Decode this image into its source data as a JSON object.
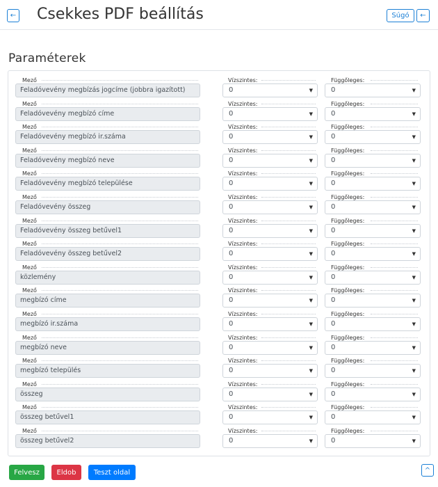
{
  "header": {
    "title": "Csekkes PDF beállítás",
    "help_label": "Súgó",
    "back_icon": "←"
  },
  "section": {
    "title": "Paraméterek"
  },
  "labels": {
    "field": "Mező",
    "horizontal": "Vízszintes:",
    "vertical": "Függőleges:"
  },
  "select_caret": "▼",
  "rows": [
    {
      "field": "Feladóvevény megbízás jogcíme (jobbra igazított)",
      "horizontal": "0",
      "vertical": "0"
    },
    {
      "field": "Feladóvevény megbízó címe",
      "horizontal": "0",
      "vertical": "0"
    },
    {
      "field": "Feladóvevény megbízó ir.száma",
      "horizontal": "0",
      "vertical": "0"
    },
    {
      "field": "Feladóvevény megbízó neve",
      "horizontal": "0",
      "vertical": "0"
    },
    {
      "field": "Feladóvevény megbízó települése",
      "horizontal": "0",
      "vertical": "0"
    },
    {
      "field": "Feladóvevény összeg",
      "horizontal": "0",
      "vertical": "0"
    },
    {
      "field": "Feladóvevény összeg betűvel1",
      "horizontal": "0",
      "vertical": "0"
    },
    {
      "field": "Feladóvevény összeg betűvel2",
      "horizontal": "0",
      "vertical": "0"
    },
    {
      "field": "közlemény",
      "horizontal": "0",
      "vertical": "0"
    },
    {
      "field": "megbízó címe",
      "horizontal": "0",
      "vertical": "0"
    },
    {
      "field": "megbízó ir.száma",
      "horizontal": "0",
      "vertical": "0"
    },
    {
      "field": "megbízó neve",
      "horizontal": "0",
      "vertical": "0"
    },
    {
      "field": "megbízó település",
      "horizontal": "0",
      "vertical": "0"
    },
    {
      "field": "összeg",
      "horizontal": "0",
      "vertical": "0"
    },
    {
      "field": "összeg betűvel1",
      "horizontal": "0",
      "vertical": "0"
    },
    {
      "field": "összeg betűvel2",
      "horizontal": "0",
      "vertical": "0"
    }
  ],
  "footer": {
    "add_label": "Felvesz",
    "discard_label": "Eldob",
    "test_label": "Teszt oldal",
    "up_icon": "^"
  }
}
